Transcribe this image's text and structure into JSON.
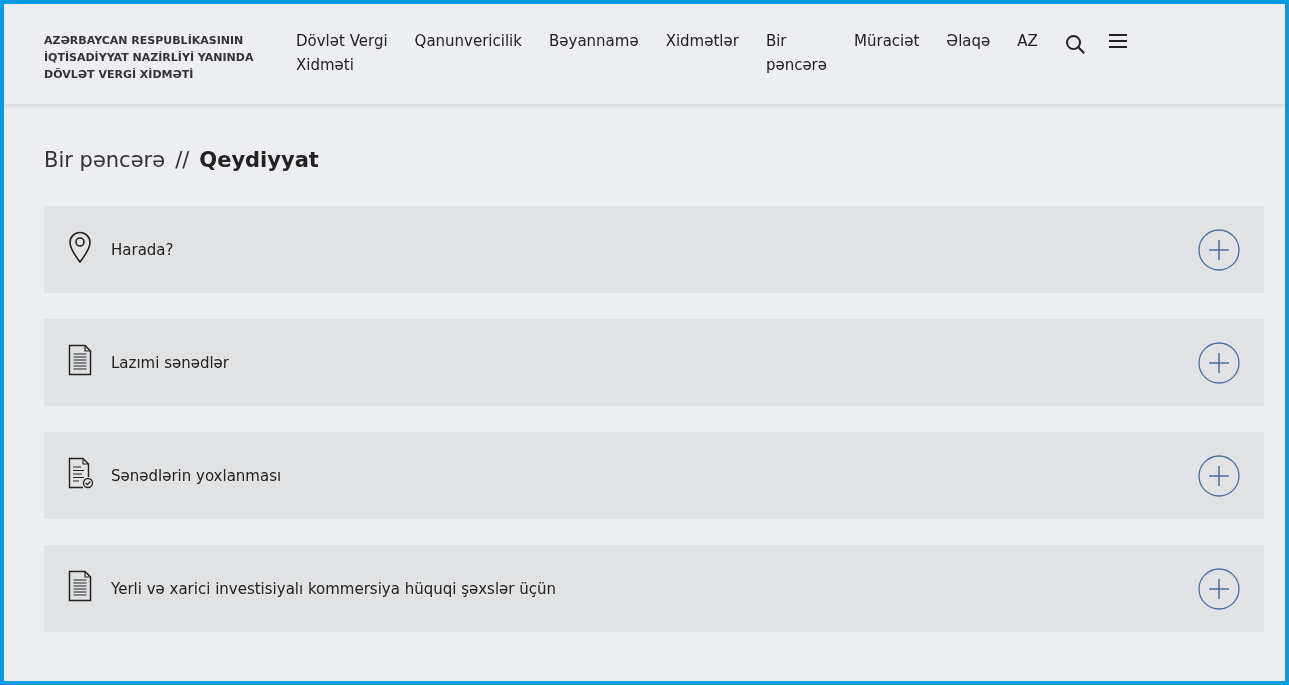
{
  "header": {
    "logo": "AZƏRBAYCAN RESPUBLİKASININ\nİQTİSADİYYAT NAZİRLİYİ YANINDA\nDÖVLƏT VERGİ XİDMƏTİ",
    "nav": [
      {
        "label": "Dövlət Vergi\nXidməti"
      },
      {
        "label": "Qanunvericilik"
      },
      {
        "label": "Bəyannamə"
      },
      {
        "label": "Xidmətlər"
      },
      {
        "label": "Bir\npəncərə"
      },
      {
        "label": "Müraciət"
      },
      {
        "label": "Əlaqə"
      },
      {
        "label": "AZ"
      }
    ]
  },
  "breadcrumb": {
    "parent": "Bir pəncərə",
    "separator": "//",
    "current": "Qeydiyyat"
  },
  "accordion": [
    {
      "kind": "location",
      "title": "Harada?",
      "expanded": false
    },
    {
      "kind": "document",
      "title": "Lazımi sənədlər",
      "expanded": false
    },
    {
      "kind": "checked-document",
      "title": "Sənədlərin yoxlanması",
      "expanded": false
    },
    {
      "kind": "document",
      "title": "Yerli və xarici investisiyalı kommersiya hüquqi şəxslər üçün",
      "expanded": false
    }
  ]
}
